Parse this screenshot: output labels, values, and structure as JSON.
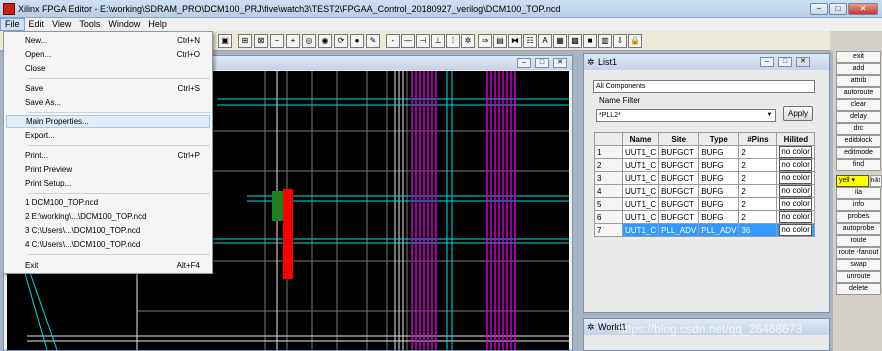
{
  "window": {
    "title": "Xilinx FPGA Editor - E:\\working\\SDRAM_PRO\\DCM100_PRJ\\five\\watch3\\TEST2\\FPGAA_Control_20180927_verilog\\DCM100_TOP.ncd",
    "minimize": "–",
    "maximize": "□",
    "close": "✕"
  },
  "menubar": [
    "File",
    "Edit",
    "View",
    "Tools",
    "Window",
    "Help"
  ],
  "file_menu": {
    "items": [
      {
        "label": "New...",
        "shortcut": "Ctrl+N"
      },
      {
        "label": "Open...",
        "shortcut": "Ctrl+O"
      },
      {
        "label": "Close",
        "shortcut": ""
      },
      {
        "label": "Save",
        "shortcut": "Ctrl+S"
      },
      {
        "label": "Save As...",
        "shortcut": ""
      },
      {
        "label": "Main Properties...",
        "shortcut": ""
      },
      {
        "label": "Export...",
        "shortcut": ""
      },
      {
        "label": "Print...",
        "shortcut": "Ctrl+P"
      },
      {
        "label": "Print Preview",
        "shortcut": ""
      },
      {
        "label": "Print Setup...",
        "shortcut": ""
      },
      {
        "label": "1 DCM100_TOP.ncd",
        "shortcut": ""
      },
      {
        "label": "2 E:\\working\\...\\DCM100_TOP.ncd",
        "shortcut": ""
      },
      {
        "label": "3 C:\\Users\\...\\DCM100_TOP.ncd",
        "shortcut": ""
      },
      {
        "label": "4 C:\\Users\\...\\DCM100_TOP.ncd",
        "shortcut": ""
      },
      {
        "label": "Exit",
        "shortcut": "Alt+F4"
      }
    ]
  },
  "list_panel": {
    "title": "List1",
    "components_combo": "All Components",
    "name_filter_label": "Name Filter",
    "filter_value": "*PLL2*",
    "apply_label": "Apply",
    "columns": [
      "",
      "Name",
      "Site",
      "Type",
      "#Pins",
      "Hilited"
    ],
    "rows": [
      [
        "1",
        "UUT1_C",
        "BUFGCT",
        "BUFG",
        "2",
        "no color"
      ],
      [
        "2",
        "UUT1_C",
        "BUFGCT",
        "BUFG",
        "2",
        "no color"
      ],
      [
        "3",
        "UUT1_C",
        "BUFGCT",
        "BUFG",
        "2",
        "no color"
      ],
      [
        "4",
        "UUT1_C",
        "BUFGCT",
        "BUFG",
        "2",
        "no color"
      ],
      [
        "5",
        "UUT1_C",
        "BUFGCT",
        "BUFG",
        "2",
        "no color"
      ],
      [
        "6",
        "UUT1_C",
        "BUFGCT",
        "BUFG",
        "2",
        "no color"
      ],
      [
        "7",
        "UUT1_C",
        "PLL_ADV",
        "PLL_ADV",
        "36",
        "no color"
      ]
    ]
  },
  "world_panel": {
    "title": "World1"
  },
  "commands": [
    "exit",
    "add",
    "attrib",
    "autoroute",
    "clear",
    "delay",
    "drc",
    "editblock",
    "editmode",
    "find",
    "ila",
    "info",
    "probes",
    "autoprobe",
    "route",
    "route -fanout",
    "swap",
    "unroute",
    "delete"
  ],
  "color_select": {
    "value": "yell",
    "hilit_label": "hilit"
  },
  "watermark": "https://blog.csdn.net/qq_26468673",
  "colors": {
    "net_magenta": "#d000d0",
    "net_cyan": "#00e0e0",
    "component_red": "#ff0000",
    "selection_blue": "#3399ff"
  }
}
